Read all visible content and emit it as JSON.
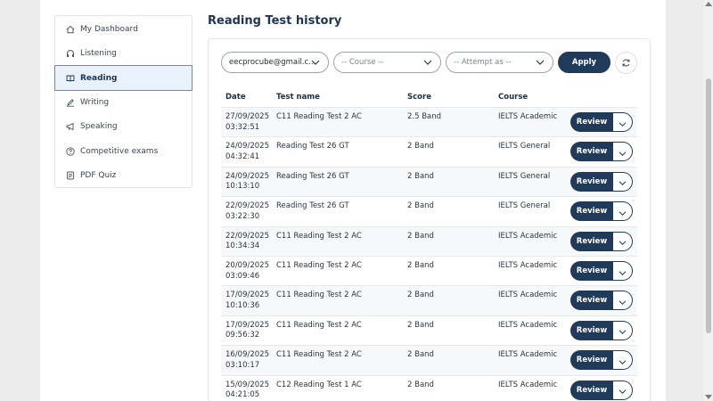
{
  "sidebar": {
    "items": [
      {
        "label": "My Dashboard",
        "icon": "home-icon"
      },
      {
        "label": "Listening",
        "icon": "headphones-icon"
      },
      {
        "label": "Reading",
        "icon": "book-open-icon",
        "active": true
      },
      {
        "label": "Writing",
        "icon": "pen-icon"
      },
      {
        "label": "Speaking",
        "icon": "megaphone-icon"
      },
      {
        "label": "Competitive exams",
        "icon": "question-circle-icon"
      },
      {
        "label": "PDF Quiz",
        "icon": "document-icon"
      }
    ]
  },
  "page": {
    "title": "Reading Test history"
  },
  "filters": {
    "email": "eecprocube@gmail.c...",
    "course_placeholder": "-- Course --",
    "attempt_placeholder": "-- Attempt as --",
    "apply_label": "Apply"
  },
  "table": {
    "headers": {
      "date": "Date",
      "test": "Test name",
      "score": "Score",
      "course": "Course"
    },
    "review_label": "Review",
    "rows": [
      {
        "date": "27/09/2025",
        "time": "03:32:51",
        "test": "C11 Reading Test 2 AC",
        "score": "2.5 Band",
        "course": "IELTS Academic"
      },
      {
        "date": "24/09/2025",
        "time": "04:32:41",
        "test": "Reading Test 26 GT",
        "score": "2 Band",
        "course": "IELTS General"
      },
      {
        "date": "24/09/2025",
        "time": "10:13:10",
        "test": "Reading Test 26 GT",
        "score": "2 Band",
        "course": "IELTS General"
      },
      {
        "date": "22/09/2025",
        "time": "03:22:30",
        "test": "Reading Test 26 GT",
        "score": "2 Band",
        "course": "IELTS General"
      },
      {
        "date": "22/09/2025",
        "time": "10:34:34",
        "test": "C11 Reading Test 2 AC",
        "score": "2 Band",
        "course": "IELTS Academic"
      },
      {
        "date": "20/09/2025",
        "time": "03:09:46",
        "test": "C11 Reading Test 2 AC",
        "score": "2 Band",
        "course": "IELTS Academic"
      },
      {
        "date": "17/09/2025",
        "time": "10:10:36",
        "test": "C11 Reading Test 2 AC",
        "score": "2 Band",
        "course": "IELTS Academic"
      },
      {
        "date": "17/09/2025",
        "time": "09:56:32",
        "test": "C11 Reading Test 2 AC",
        "score": "2 Band",
        "course": "IELTS Academic"
      },
      {
        "date": "16/09/2025",
        "time": "03:10:17",
        "test": "C11 Reading Test 2 AC",
        "score": "2 Band",
        "course": "IELTS Academic"
      },
      {
        "date": "15/09/2025",
        "time": "04:21:05",
        "test": "C12 Reading Test 1 AC",
        "score": "2 Band",
        "course": "IELTS Academic"
      }
    ]
  },
  "colors": {
    "primary": "#203a5a",
    "active_bg": "#e9f2fb",
    "active_border": "#5f8dbd"
  }
}
